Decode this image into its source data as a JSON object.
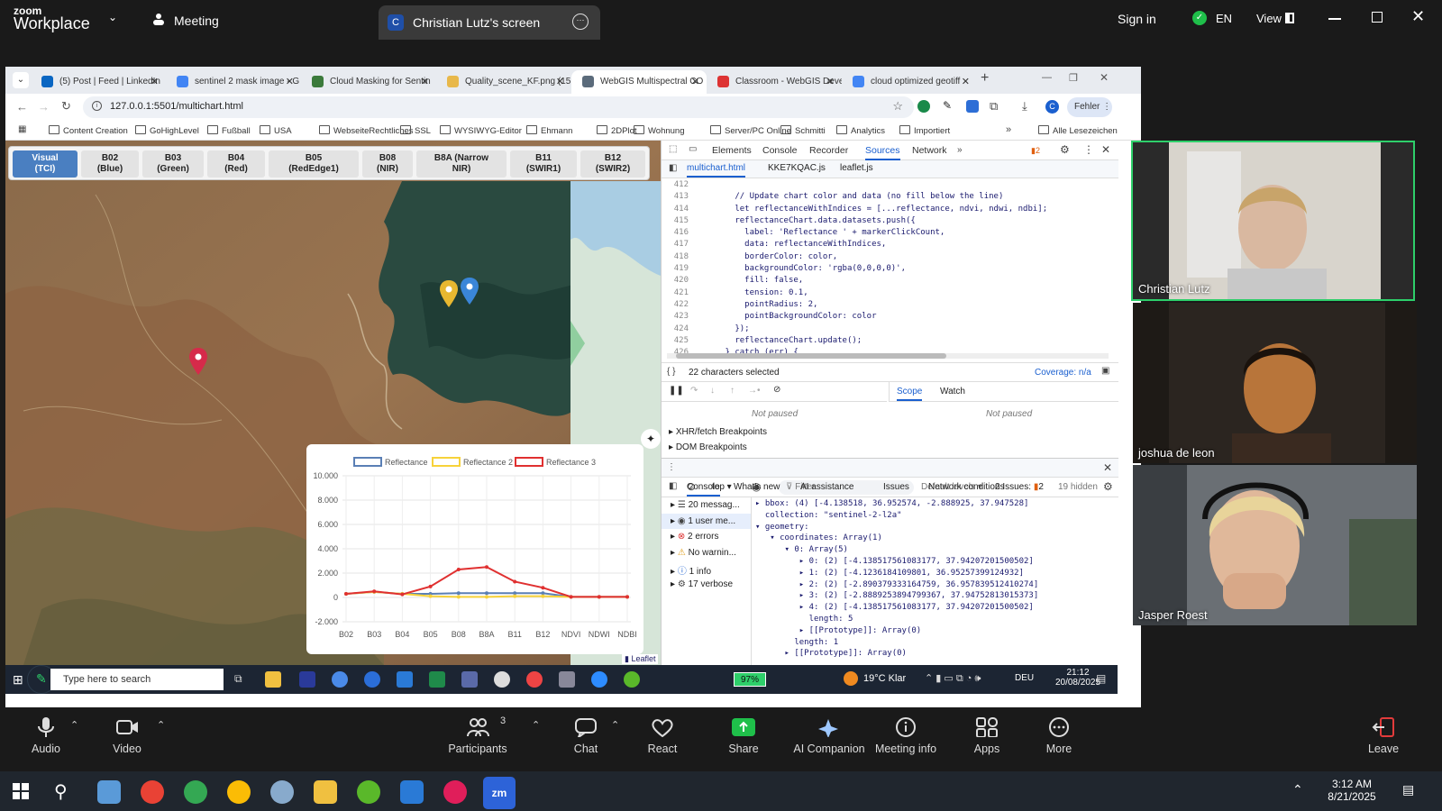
{
  "zoom": {
    "logo_top": "zoom",
    "logo_bottom": "Workplace",
    "meeting_label": "Meeting",
    "share_initial": "C",
    "share_title": "Christian Lutz's screen",
    "sign_in": "Sign in",
    "lang": "EN",
    "view": "View"
  },
  "browser": {
    "tabs": [
      {
        "label": "(5) Post | Feed | LinkedIn",
        "color": "#0a66c2"
      },
      {
        "label": "sentinel 2 mask image - G",
        "color": "#4285f4"
      },
      {
        "label": "Cloud Masking for Sentin",
        "color": "#3b7a3b"
      },
      {
        "label": "Quality_scene_KF.png (15",
        "color": "#e8b84a"
      },
      {
        "label": "WebGIS Multispectral CO",
        "color": "#5b6b7b"
      },
      {
        "label": "Classroom - WebGIS Deve",
        "color": "#d33"
      },
      {
        "label": "cloud optimized geotiff",
        "color": "#4285f4"
      }
    ],
    "url": "127.0.0.1:5501/multichart.html",
    "error_badge": "Fehler",
    "profile_initial": "C",
    "bookmarks": [
      "Content Creation",
      "GoHighLevel",
      "Fußball",
      "USA",
      "WebseiteRechtliches",
      "SSL",
      "WYSIWYG-Editor",
      "Ehmann",
      "2DPlot",
      "Wohnung",
      "Server/PC Online",
      "Schmitti",
      "Analytics",
      "Importiert"
    ],
    "all_bookmarks": "Alle Lesezeichen"
  },
  "bands": [
    {
      "l1": "Visual",
      "l2": "(TCI)"
    },
    {
      "l1": "B02",
      "l2": "(Blue)"
    },
    {
      "l1": "B03",
      "l2": "(Green)"
    },
    {
      "l1": "B04",
      "l2": "(Red)"
    },
    {
      "l1": "B05",
      "l2": "(RedEdge1)"
    },
    {
      "l1": "B08",
      "l2": "(NIR)"
    },
    {
      "l1": "B8A (Narrow",
      "l2": "NIR)"
    },
    {
      "l1": "B11",
      "l2": "(SWIR1)"
    },
    {
      "l1": "B12",
      "l2": "(SWIR2)"
    }
  ],
  "map": {
    "attribution": "Leaflet",
    "marker_colors": [
      "#e8b830",
      "#3a86d8",
      "#d62a4a"
    ]
  },
  "chart_data": {
    "type": "line",
    "categories": [
      "B02",
      "B03",
      "B04",
      "B05",
      "B08",
      "B8A",
      "B11",
      "B12",
      "NDVI",
      "NDWI",
      "NDBI"
    ],
    "ylim": [
      -2000,
      10000
    ],
    "yticks": [
      "10.000",
      "8.000",
      "6.000",
      "4.000",
      "2.000",
      "0",
      "-2.000"
    ],
    "series": [
      {
        "name": "Reflectance",
        "color": "#5a7fb5",
        "values": [
          300,
          450,
          300,
          300,
          350,
          350,
          350,
          350,
          50,
          50,
          50
        ]
      },
      {
        "name": "Reflectance 2",
        "color": "#f7d23a",
        "values": [
          300,
          450,
          300,
          100,
          50,
          50,
          100,
          100,
          50,
          50,
          50
        ]
      },
      {
        "name": "Reflectance 3",
        "color": "#e03030",
        "values": [
          300,
          500,
          250,
          900,
          2300,
          2500,
          1300,
          800,
          50,
          50,
          50
        ]
      }
    ]
  },
  "devtools": {
    "tabs": [
      "Elements",
      "Console",
      "Recorder",
      "Sources",
      "Network"
    ],
    "issues_count": "2",
    "files": [
      "multichart.html",
      "KKE7KQAC.js",
      "leaflet.js"
    ],
    "code_lines": [
      {
        "n": "412",
        "t": ""
      },
      {
        "n": "413",
        "t": "        // Update chart color and data (no fill below the line)"
      },
      {
        "n": "414",
        "t": "        let reflectanceWithIndices = [...reflectance, ndvi, ndwi, ndbi];"
      },
      {
        "n": "415",
        "t": "        reflectanceChart.data.datasets.push({"
      },
      {
        "n": "416",
        "t": "          label: 'Reflectance ' + markerClickCount,"
      },
      {
        "n": "417",
        "t": "          data: reflectanceWithIndices,"
      },
      {
        "n": "418",
        "t": "          borderColor: color,"
      },
      {
        "n": "419",
        "t": "          backgroundColor: 'rgba(0,0,0,0)',"
      },
      {
        "n": "420",
        "t": "          fill: false,"
      },
      {
        "n": "421",
        "t": "          tension: 0.1,"
      },
      {
        "n": "422",
        "t": "          pointRadius: 2,"
      },
      {
        "n": "423",
        "t": "          pointBackgroundColor: color"
      },
      {
        "n": "424",
        "t": "        });"
      },
      {
        "n": "425",
        "t": "        reflectanceChart.update();"
      },
      {
        "n": "426",
        "t": "      } catch (err) {"
      }
    ],
    "selected_info": "22 characters selected",
    "coverage": "Coverage: n/a",
    "scope_tab": "Scope",
    "watch_tab": "Watch",
    "not_paused_left": "Not paused",
    "not_paused_right": "Not paused",
    "breakpoints": [
      "XHR/fetch Breakpoints",
      "DOM Breakpoints"
    ],
    "drawer_tabs": [
      "Console",
      "What's new",
      "AI assistance",
      "Issues",
      "Network conditions"
    ],
    "context": "top",
    "filter_placeholder": "Filter",
    "levels": "Default levels",
    "issues_label": "2 Issues:",
    "issues_num": "2",
    "hidden": "19 hidden",
    "sidebar_items": [
      "20 messag...",
      "1 user me...",
      "2 errors",
      "No warnin...",
      "1 info",
      "17 verbose"
    ],
    "console_lines": [
      "▸ bbox: (4) [-4.138518, 36.952574, -2.888925, 37.947528]",
      "  collection: \"sentinel-2-l2a\"",
      "▾ geometry:",
      "   ▾ coordinates: Array(1)",
      "      ▾ 0: Array(5)",
      "         ▸ 0: (2) [-4.138517561083177, 37.94207201500502]",
      "         ▸ 1: (2) [-4.123618410980​1, 36.95257399124932]",
      "         ▸ 2: (2) [-2.890379333164759, 36.957839512410274]",
      "         ▸ 3: (2) [-2.888925389479936​7, 37.94752813015373]",
      "         ▸ 4: (2) [-4.138517561083177, 37.94207201500502]",
      "           length: 5",
      "         ▸ [[Prototype]]: Array(0)",
      "        length: 1",
      "      ▸ [[Prototype]]: Array(0)"
    ]
  },
  "taskbar_inner": {
    "search_placeholder": "Type here to search",
    "battery": "97%",
    "weather": "19°C  Klar",
    "lang": "DEU",
    "time": "21:12",
    "date": "20/08/2025"
  },
  "participants": [
    {
      "name": "Christian Lutz"
    },
    {
      "name": "joshua de leon"
    },
    {
      "name": "Jasper Roest"
    }
  ],
  "zoom_bar": {
    "audio": "Audio",
    "video": "Video",
    "participants": "Participants",
    "participants_count": "3",
    "chat": "Chat",
    "react": "React",
    "share": "Share",
    "ai": "AI Companion",
    "info": "Meeting info",
    "apps": "Apps",
    "more": "More",
    "leave": "Leave"
  },
  "win": {
    "time": "3:12 AM",
    "date": "8/21/2025"
  }
}
